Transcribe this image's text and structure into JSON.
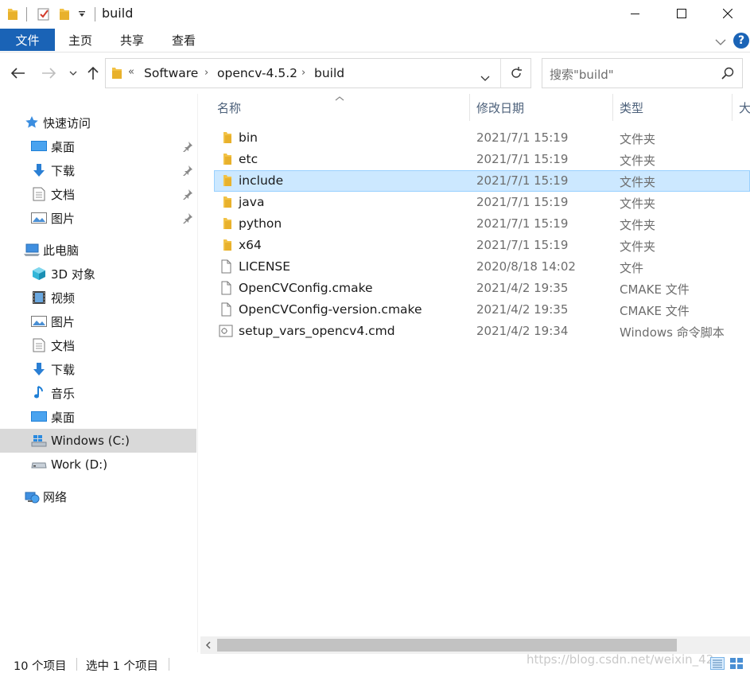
{
  "window": {
    "title": "build",
    "minimize_icon": "minimize-icon",
    "maximize_icon": "maximize-icon",
    "close_icon": "close-icon"
  },
  "ribbon": {
    "file_tab": "文件",
    "tabs": [
      "主页",
      "共享",
      "查看"
    ],
    "help_label": "?"
  },
  "address": {
    "overflow": "«",
    "crumbs": [
      "Software",
      "opencv-4.5.2",
      "build"
    ],
    "search_placeholder": "搜索\"build\""
  },
  "sidebar": {
    "quick_access": "快速访问",
    "quick_items": [
      {
        "label": "桌面",
        "icon": "desktop-icon"
      },
      {
        "label": "下载",
        "icon": "download-icon"
      },
      {
        "label": "文档",
        "icon": "documents-icon"
      },
      {
        "label": "图片",
        "icon": "pictures-icon"
      }
    ],
    "this_pc": "此电脑",
    "pc_items": [
      {
        "label": "3D 对象",
        "icon": "3d-objects-icon"
      },
      {
        "label": "视频",
        "icon": "videos-icon"
      },
      {
        "label": "图片",
        "icon": "pictures-icon"
      },
      {
        "label": "文档",
        "icon": "documents-icon"
      },
      {
        "label": "下载",
        "icon": "download-icon"
      },
      {
        "label": "音乐",
        "icon": "music-icon"
      },
      {
        "label": "桌面",
        "icon": "desktop-icon"
      },
      {
        "label": "Windows (C:)",
        "icon": "windows-drive-icon"
      },
      {
        "label": "Work (D:)",
        "icon": "drive-icon"
      }
    ],
    "network": "网络"
  },
  "columns": {
    "name": "名称",
    "modified": "修改日期",
    "type": "类型",
    "size": "大"
  },
  "files": [
    {
      "name": "bin",
      "modified": "2021/7/1 15:19",
      "type": "文件夹",
      "icon": "folder-icon"
    },
    {
      "name": "etc",
      "modified": "2021/7/1 15:19",
      "type": "文件夹",
      "icon": "folder-icon"
    },
    {
      "name": "include",
      "modified": "2021/7/1 15:19",
      "type": "文件夹",
      "icon": "folder-icon",
      "selected": true
    },
    {
      "name": "java",
      "modified": "2021/7/1 15:19",
      "type": "文件夹",
      "icon": "folder-icon"
    },
    {
      "name": "python",
      "modified": "2021/7/1 15:19",
      "type": "文件夹",
      "icon": "folder-icon"
    },
    {
      "name": "x64",
      "modified": "2021/7/1 15:19",
      "type": "文件夹",
      "icon": "folder-icon"
    },
    {
      "name": "LICENSE",
      "modified": "2020/8/18 14:02",
      "type": "文件",
      "icon": "file-icon"
    },
    {
      "name": "OpenCVConfig.cmake",
      "modified": "2021/4/2 19:35",
      "type": "CMAKE 文件",
      "icon": "file-icon"
    },
    {
      "name": "OpenCVConfig-version.cmake",
      "modified": "2021/4/2 19:35",
      "type": "CMAKE 文件",
      "icon": "file-icon"
    },
    {
      "name": "setup_vars_opencv4.cmd",
      "modified": "2021/4/2 19:34",
      "type": "Windows 命令脚本",
      "icon": "script-file-icon"
    }
  ],
  "status": {
    "count": "10 个项目",
    "selected": "选中 1 个项目"
  },
  "watermark": "https://blog.csdn.net/weixin_42",
  "colors": {
    "accent": "#1a63b6",
    "selection": "#cce8ff",
    "folder": "#f2c246"
  }
}
